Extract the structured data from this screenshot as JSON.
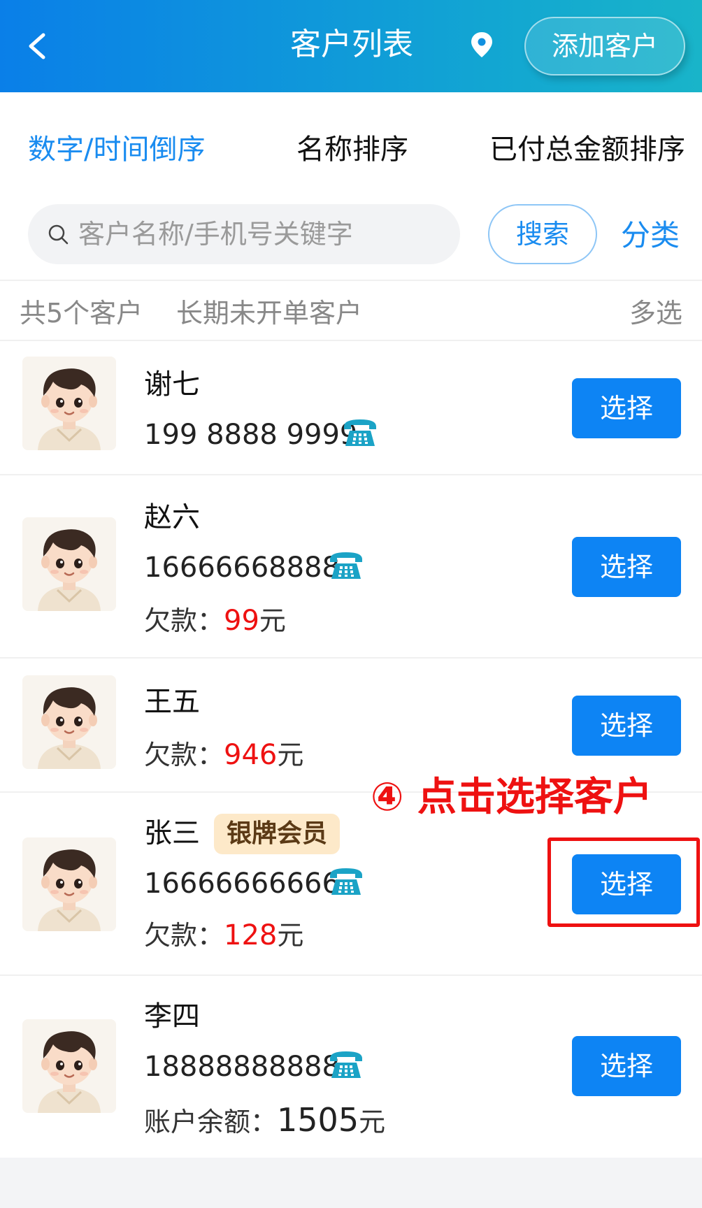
{
  "header": {
    "title": "客户列表",
    "add_button": "添加客户",
    "back_icon": "chevron-left-icon",
    "location_icon": "map-pin-icon"
  },
  "sort_tabs": [
    {
      "label": "数字/时间倒序",
      "active": true
    },
    {
      "label": "名称排序",
      "active": false
    },
    {
      "label": "已付总金额排序",
      "active": false
    }
  ],
  "search": {
    "placeholder": "客户名称/手机号关键字",
    "button": "搜索",
    "category": "分类"
  },
  "summary": {
    "count_text": "共5个客户",
    "long_inactive": "长期未开单客户",
    "multi_select": "多选"
  },
  "customers": [
    {
      "name": "谢七",
      "phone": "199 8888 9999",
      "select_label": "选择"
    },
    {
      "name": "赵六",
      "phone": "16666668888",
      "money_label": "欠款：",
      "money_value": "99",
      "money_unit": "元",
      "select_label": "选择"
    },
    {
      "name": "王五",
      "money_label": "欠款：",
      "money_value": "946",
      "money_unit": "元",
      "select_label": "选择"
    },
    {
      "name": "张三",
      "badge": "银牌会员",
      "phone": "16666666666",
      "money_label": "欠款：",
      "money_value": "128",
      "money_unit": "元",
      "select_label": "选择"
    },
    {
      "name": "李四",
      "phone": "18888888888",
      "money_label": "账户余额：",
      "money_value": "1505",
      "money_unit": "元",
      "select_label": "选择"
    }
  ],
  "annotation": {
    "text": "④ 点击选择客户",
    "color": "#ee1111"
  },
  "colors": {
    "accent": "#1a8cf0",
    "button": "#0d84f4",
    "debt_red": "#ee1111"
  }
}
